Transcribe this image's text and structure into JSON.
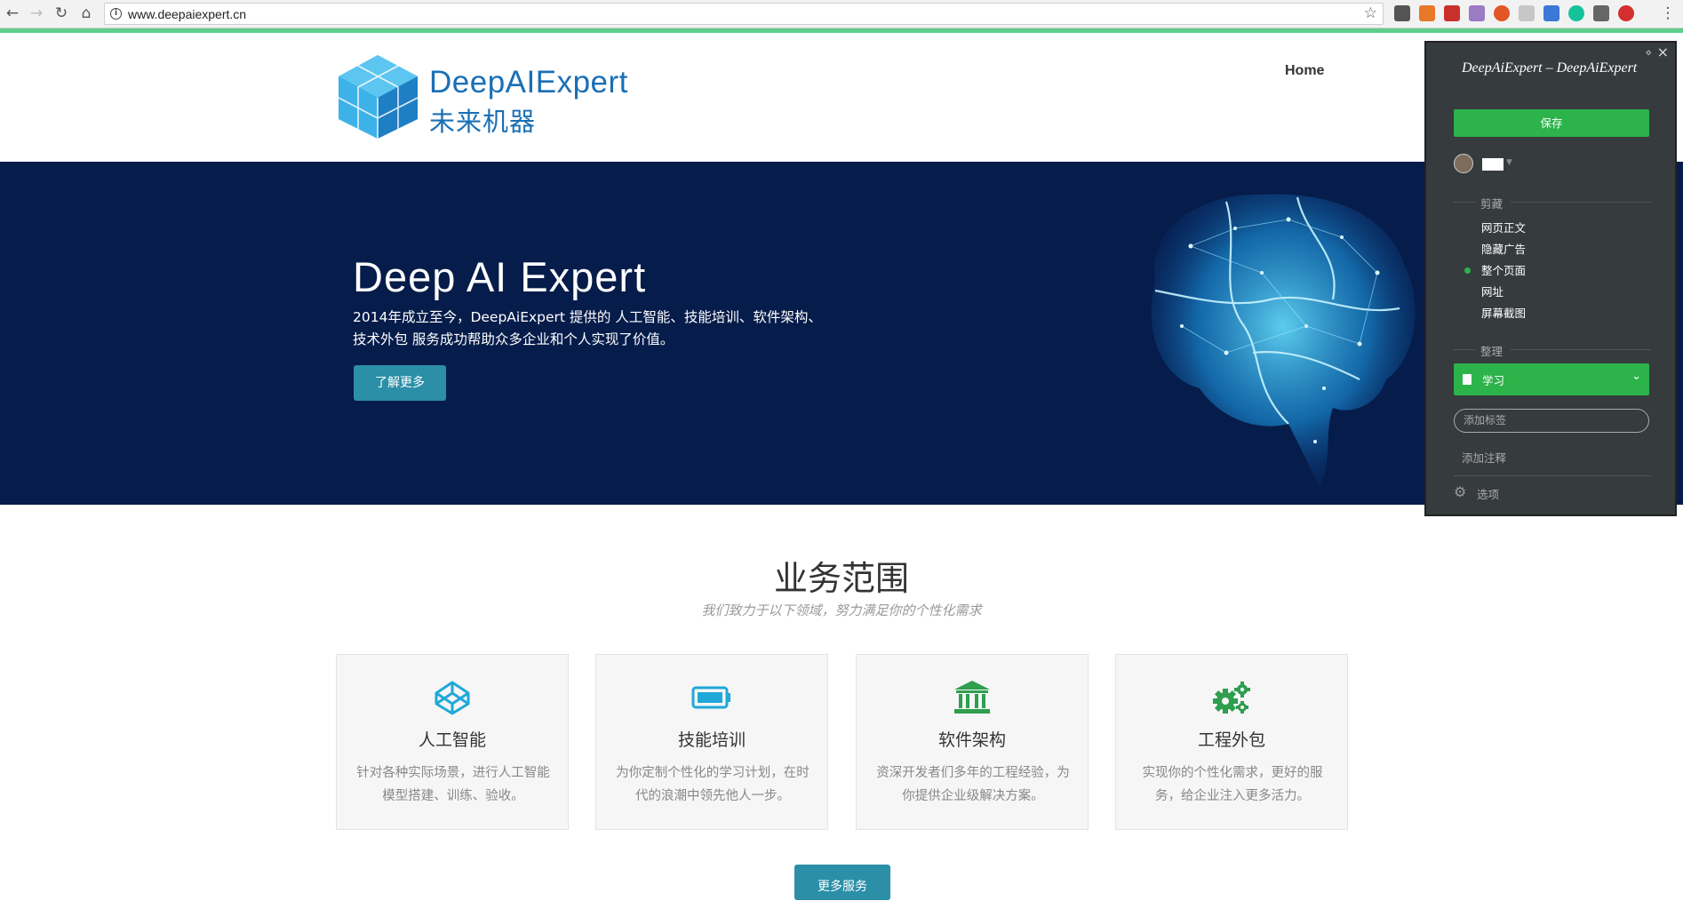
{
  "browser": {
    "url": "www.deepaiexpert.cn",
    "back_icon": "back-arrow-icon",
    "forward_icon": "forward-arrow-icon",
    "reload_icon": "reload-icon",
    "home_icon": "home-icon"
  },
  "header": {
    "logo_en": "DeepAIExpert",
    "logo_cn": "未来机器",
    "nav_home": "Home"
  },
  "hero": {
    "title": "Deep AI Expert",
    "description": "2014年成立至今，DeepAiExpert 提供的 人工智能、技能培训、软件架构、技术外包 服务成功帮助众多企业和个人实现了价值。",
    "button": "了解更多"
  },
  "services": {
    "title": "业务范围",
    "subtitle": "我们致力于以下领域，努力满足你的个性化需求",
    "cards": [
      {
        "icon": "codepen-icon",
        "title": "人工智能",
        "desc": "针对各种实际场景，进行人工智能模型搭建、训练、验收。"
      },
      {
        "icon": "battery-icon",
        "title": "技能培训",
        "desc": "为你定制个性化的学习计划，在时代的浪潮中领先他人一步。"
      },
      {
        "icon": "bank-icon",
        "title": "软件架构",
        "desc": "资深开发者们多年的工程经验，为你提供企业级解决方案。"
      },
      {
        "icon": "gears-icon",
        "title": "工程外包",
        "desc": "实现你的个性化需求，更好的服务，给企业注入更多活力。"
      }
    ],
    "more_button": "更多服务"
  },
  "clipper": {
    "title": "DeepAiExpert – DeepAiExpert",
    "save": "保存",
    "clip_label": "剪藏",
    "clip_options": [
      "网页正文",
      "隐藏广告",
      "整个页面",
      "网址",
      "屏幕截图"
    ],
    "selected_option": "整个页面",
    "organize_label": "整理",
    "notebook": "学习",
    "tag_placeholder": "添加标签",
    "add_note": "添加注释",
    "options": "选项"
  },
  "colors": {
    "brand_blue": "#1a6fb5",
    "hero_bg": "#061c4a",
    "teal_button": "#2b8fa8",
    "clipper_green": "#2cb34a"
  }
}
